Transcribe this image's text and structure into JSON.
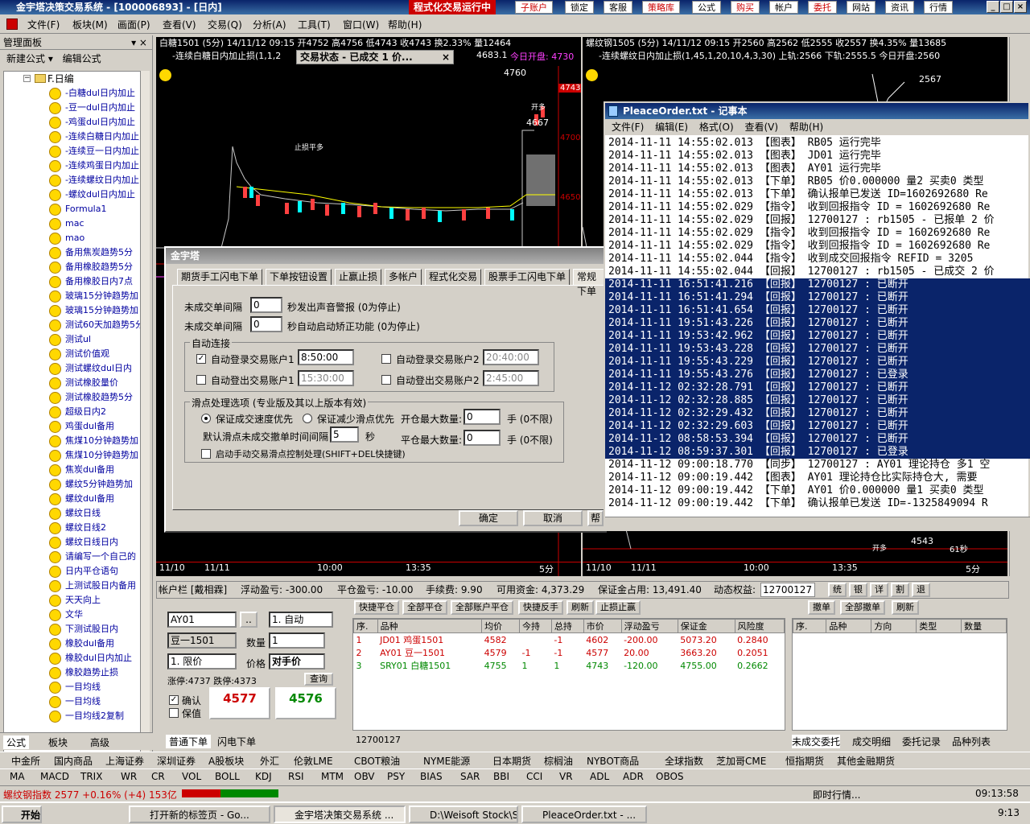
{
  "app": {
    "title": "金宇塔决策交易系统 - [100006893] - [日内]",
    "running": "程式化交易运行中",
    "top_buttons": [
      "子账户",
      "锁定",
      "客服",
      "策略库",
      "公式",
      "购买",
      "帐户",
      "委托",
      "网站",
      "资讯",
      "行情"
    ]
  },
  "menu": [
    "文件(F)",
    "板块(M)",
    "画面(P)",
    "查看(V)",
    "交易(Q)",
    "分析(A)",
    "工具(T)",
    "窗口(W)",
    "帮助(H)"
  ],
  "left_panel": {
    "title": "管理面板",
    "toolbar": [
      "新建公式",
      "编辑公式"
    ],
    "folder": "F.日编",
    "items": [
      "-白糖dul日内加止",
      "-豆一dul日内加止",
      "-鸡蛋dul日内加止",
      "-连续白糖日内加止",
      "-连续豆一日内加止",
      "-连续鸡蛋日内加止",
      "-连续螺纹日内加止",
      "-螺纹dul日内加止",
      "Formula1",
      "mac",
      "mao",
      "备用焦炭趋势5分",
      "备用橡胶趋势5分",
      "备用橡胶日内7点",
      "玻璃15分钟趋势加",
      "玻璃15分钟趋势加",
      "测试60天加趋势5分",
      "测试ul",
      "测试价值观",
      "测试螺纹dul日内",
      "测试橡胶量价",
      "测试橡胶趋势5分",
      "超级日内2",
      "鸡蛋dul备用",
      "焦煤10分钟趋势加",
      "焦煤10分钟趋势加",
      "焦炭dul备用",
      "螺纹5分钟趋势加",
      "螺纹dul备用",
      "螺纹日线",
      "螺纹日线2",
      "螺纹日线日内",
      "请编写一个自己的",
      "日内平仓语句",
      "上测试股日内备用",
      "天天向上",
      "文华",
      "下测试股日内",
      "橡胶dul备用",
      "橡胶dul日内加止",
      "橡胶趋势止损",
      "一目均线",
      "一目均线",
      "一目均线2复制"
    ],
    "tabs": [
      "公式",
      "板块",
      "高级"
    ]
  },
  "chart_left": {
    "title": "白糖1501 (5分) 14/11/12 09:15 开4752 高4756 低4743 收4743 换2.33% 量12464",
    "subtitle": "-连续白糖日内加止损(1,1,2",
    "open_label": "今日开盘: 4730",
    "price_4683": "4683.1",
    "axis": [
      "4760",
      "4743",
      "4700",
      "4650",
      "4580"
    ],
    "marks": [
      "止损平多",
      "4760",
      "4667",
      "开多"
    ],
    "dates": [
      "11/10",
      "11/11",
      "10:00",
      "13:35",
      "5分"
    ]
  },
  "chart_right": {
    "title": "螺纹钢1505 (5分) 14/11/12 09:15 开2560 高2562 低2555 收2557 换4.35% 量13685",
    "subtitle": "-连续螺纹日内加止损(1,45,1,20,10,4,3,30) 上轨:2566 下轨:2555.5 今日开盘:2560",
    "marks": [
      "2567",
      "4543",
      "开多",
      "61秒"
    ],
    "dates": [
      "11/10",
      "11/11",
      "10:00",
      "13:35",
      "5分"
    ]
  },
  "toast": {
    "text": "交易状态 - 已成交 1 价..."
  },
  "dialog": {
    "title": "金宇塔",
    "tabs": [
      "期货手工闪电下单",
      "下单按钮设置",
      "止赢止损",
      "多帐户",
      "程式化交易",
      "股票手工闪电下单",
      "常规下单"
    ],
    "rows": [
      {
        "label": "未成交单间隔",
        "value": "0",
        "suffix": "秒发出声音警报 (0为停止)"
      },
      {
        "label": "未成交单间隔",
        "value": "0",
        "suffix": "秒自动启动矫正功能 (0为停止)"
      }
    ],
    "group_auto": "自动连接",
    "auto_login1": "自动登录交易账户1",
    "auto_login1_time": "8:50:00",
    "auto_login2": "自动登录交易账户2",
    "auto_login2_time": "20:40:00",
    "auto_logout1": "自动登出交易账户1",
    "auto_logout1_time": "15:30:00",
    "auto_logout2": "自动登出交易账户2",
    "auto_logout2_time": "2:45:00",
    "group_slip": "滑点处理选项 (专业版及其以上版本有效)",
    "radio1": "保证成交速度优先",
    "radio2": "保证减少滑点优先",
    "open_max_label": "开仓最大数量:",
    "open_max": "0",
    "close_max_label": "平仓最大数量:",
    "close_max": "0",
    "unit": "手 (0不限)",
    "default_slip": "默认滑点未成交撤单时间间隔",
    "default_slip_val": "5",
    "sec": "秒",
    "manual": "启动手动交易滑点控制处理(SHIFT+DEL快捷键)",
    "ok": "确定",
    "cancel": "取消",
    "apply": "帮"
  },
  "notepad": {
    "title": "PleaceOrder.txt - 记事本",
    "menu": "文件(F) 编辑(E) 格式(O) 查看(V) 帮助(H)",
    "lines": [
      "2014-11-11 14:55:02.013  【图表】 RB05 运行完毕",
      "2014-11-11 14:55:02.013  【图表】 JD01 运行完毕",
      "2014-11-11 14:55:02.013  【图表】 AY01 运行完毕",
      "2014-11-11 14:55:02.013  【下单】 RB05 价0.000000 量2 买卖0 类型",
      "2014-11-11 14:55:02.013  【下单】 确认报单已发送 ID=1602692680 Re",
      "2014-11-11 14:55:02.029  【指令】 收到回报指令 ID = 1602692680 Re",
      "2014-11-11 14:55:02.029  【回报】 12700127 : rb1505 - 已报单 2 价",
      "2014-11-11 14:55:02.029  【指令】 收到回报指令 ID = 1602692680 Re",
      "2014-11-11 14:55:02.029  【指令】 收到回报指令 ID = 1602692680 Re",
      "2014-11-11 14:55:02.044  【指令】 收到成交回报指令 REFID = 3205",
      "2014-11-11 14:55:02.044  【回报】 12700127 : rb1505 - 已成交 2 价",
      "2014-11-11 16:51:41.216  【回报】 12700127 : 已断开",
      "2014-11-11 16:51:41.294  【回报】 12700127 : 已断开",
      "2014-11-11 16:51:41.654  【回报】 12700127 : 已断开",
      "2014-11-11 19:51:43.226  【回报】 12700127 : 已断开",
      "2014-11-11 19:53:42.962  【回报】 12700127 : 已断开",
      "2014-11-11 19:53:43.228  【回报】 12700127 : 已断开",
      "2014-11-11 19:55:43.229  【回报】 12700127 : 已断开",
      "2014-11-11 19:55:43.276  【回报】 12700127 : 已登录",
      "2014-11-12 02:32:28.791  【回报】 12700127 : 已断开",
      "2014-11-12 02:32:28.885  【回报】 12700127 : 已断开",
      "2014-11-12 02:32:29.432  【回报】 12700127 : 已断开",
      "2014-11-12 02:32:29.603  【回报】 12700127 : 已断开",
      "2014-11-12 08:58:53.394  【回报】 12700127 : 已断开",
      "2014-11-12 08:59:37.301  【回报】 12700127 : 已登录",
      "2014-11-12 09:00:18.770  【同步】 12700127 : AY01 理论持仓 多1 空",
      "2014-11-12 09:00:19.442  【图表】 AY01 理论持仓比实际持仓大, 需要",
      "2014-11-12 09:00:19.442  【下单】 AY01 价0.000000 量1 买卖0 类型",
      "2014-11-12 09:00:19.442  【下单】 确认报单已发送 ID=-1325849094 R"
    ],
    "sel_start": 11,
    "sel_end": 24
  },
  "account": {
    "label": "帐户栏 [戴相霖]",
    "float_pl": "浮动盈亏: -300.00",
    "close_pl": "平仓盈亏: -10.00",
    "fee": "手续费: 9.90",
    "avail": "可用资金: 4,373.29",
    "margin": "保证金占用: 13,491.40",
    "equity": "动态权益:",
    "acct_id": "12700127",
    "mini_btns": [
      "统",
      "银",
      "详",
      "割",
      "退"
    ]
  },
  "order": {
    "symbol_code": "AY01",
    "symbol_name": "豆一1501",
    "mode": "1. 自动",
    "qty_label": "数量",
    "qty": "1",
    "price_type": "1. 限价",
    "price_label": "价格",
    "price": "对手价",
    "query": "查询",
    "limit_up": "涨停:4737",
    "limit_down": "跌停:4373",
    "confirm": "确认",
    "protect": "保值",
    "buy_price": "4577",
    "sell_price": "4576",
    "tabs": [
      "普通下单",
      "闪电下单"
    ]
  },
  "positions": {
    "buttons": [
      "快捷平仓",
      "全部平仓",
      "全部账户平仓",
      "快捷反手",
      "刷新",
      "止损止赢"
    ],
    "headers": [
      "序.",
      "品种",
      "均价",
      "今持",
      "总持",
      "市价",
      "浮动盈亏",
      "保证金",
      "风险度"
    ],
    "rows": [
      [
        "1",
        "JD01 鸡蛋1501",
        "4582",
        "",
        "-1",
        "4602",
        "-200.00",
        "5073.20",
        "0.2840"
      ],
      [
        "2",
        "AY01 豆一1501",
        "4579",
        "-1",
        "-1",
        "4577",
        "20.00",
        "3663.20",
        "0.2051"
      ],
      [
        "3",
        "SRY01 白糖1501",
        "4755",
        "1",
        "1",
        "4743",
        "-120.00",
        "4755.00",
        "0.2662"
      ]
    ],
    "account_tab": "12700127"
  },
  "orders_panel": {
    "buttons": [
      "撤单",
      "全部撤单",
      "刷新"
    ],
    "headers": [
      "序.",
      "品种",
      "方向",
      "类型",
      "数量"
    ],
    "tabs": [
      "未成交委托",
      "成交明细",
      "委托记录",
      "品种列表"
    ]
  },
  "market_tabs": [
    "中金所",
    "国内商品",
    "上海证券",
    "深圳证券",
    "A股板块",
    "外汇",
    "伦敦LME",
    "CBOT粮油",
    "NYME能源",
    "日本期货",
    "棕榈油",
    "NYBOT商品",
    "全球指数",
    "芝加哥CME",
    "恒指期货",
    "其他金融期货"
  ],
  "indicators": [
    "MA",
    "MACD",
    "TRIX",
    "WR",
    "CR",
    "VOL",
    "BOLL",
    "KDJ",
    "RSI",
    "MTM",
    "OBV",
    "PSY",
    "BIAS",
    "SAR",
    "BBI",
    "CCI",
    "VR",
    "ADL",
    "ADR",
    "OBOS"
  ],
  "status": {
    "index": "螺纹钢指数 2577 +0.16% (+4) 153亿",
    "realtime": "即时行情...",
    "time": "09:13:58"
  },
  "taskbar": {
    "start": "开始",
    "tasks": [
      "打开新的标签页 - Go...",
      "金宇塔决策交易系统 ...",
      "D:\\Weisoft Stock\\Se...",
      "PleaceOrder.txt - ..."
    ],
    "clock": "9:13"
  }
}
